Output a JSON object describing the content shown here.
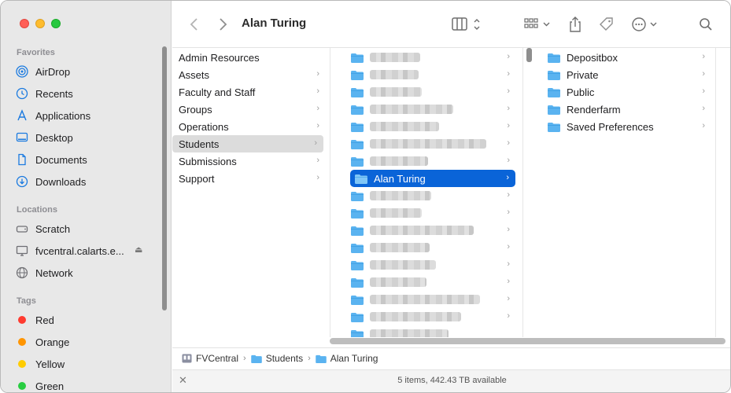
{
  "window": {
    "title": "Alan Turing"
  },
  "sidebar": {
    "favorites_header": "Favorites",
    "favorites": [
      {
        "label": "AirDrop",
        "icon": "airdrop-icon"
      },
      {
        "label": "Recents",
        "icon": "clock-icon"
      },
      {
        "label": "Applications",
        "icon": "applications-icon"
      },
      {
        "label": "Desktop",
        "icon": "desktop-icon"
      },
      {
        "label": "Documents",
        "icon": "document-icon"
      },
      {
        "label": "Downloads",
        "icon": "download-icon"
      }
    ],
    "locations_header": "Locations",
    "locations": [
      {
        "label": "Scratch",
        "icon": "drive-icon"
      },
      {
        "label": "fvcentral.calarts.e...",
        "icon": "display-icon"
      },
      {
        "label": "Network",
        "icon": "globe-icon"
      }
    ],
    "tags_header": "Tags",
    "tags": [
      {
        "label": "Red",
        "color": "#ff3b30"
      },
      {
        "label": "Orange",
        "color": "#ff9500"
      },
      {
        "label": "Yellow",
        "color": "#ffcc00"
      },
      {
        "label": "Green",
        "color": "#28cd41"
      }
    ]
  },
  "columns": {
    "col1": [
      "Admin Resources",
      "Assets",
      "Faculty and Staff",
      "Groups",
      "Operations",
      "Students",
      "Submissions",
      "Support"
    ],
    "col1_selected": "Students",
    "col2_selected": "Alan Turing",
    "col3": [
      "Depositbox",
      "Private",
      "Public",
      "Renderfarm",
      "Saved Preferences"
    ]
  },
  "pathbar": {
    "crumbs": [
      "FVCentral",
      "Students",
      "Alan Turing"
    ]
  },
  "status": {
    "text": "5 items, 442.43 TB available"
  },
  "colors": {
    "accent": "#0a64d8",
    "folder": "#5ab3f0"
  }
}
